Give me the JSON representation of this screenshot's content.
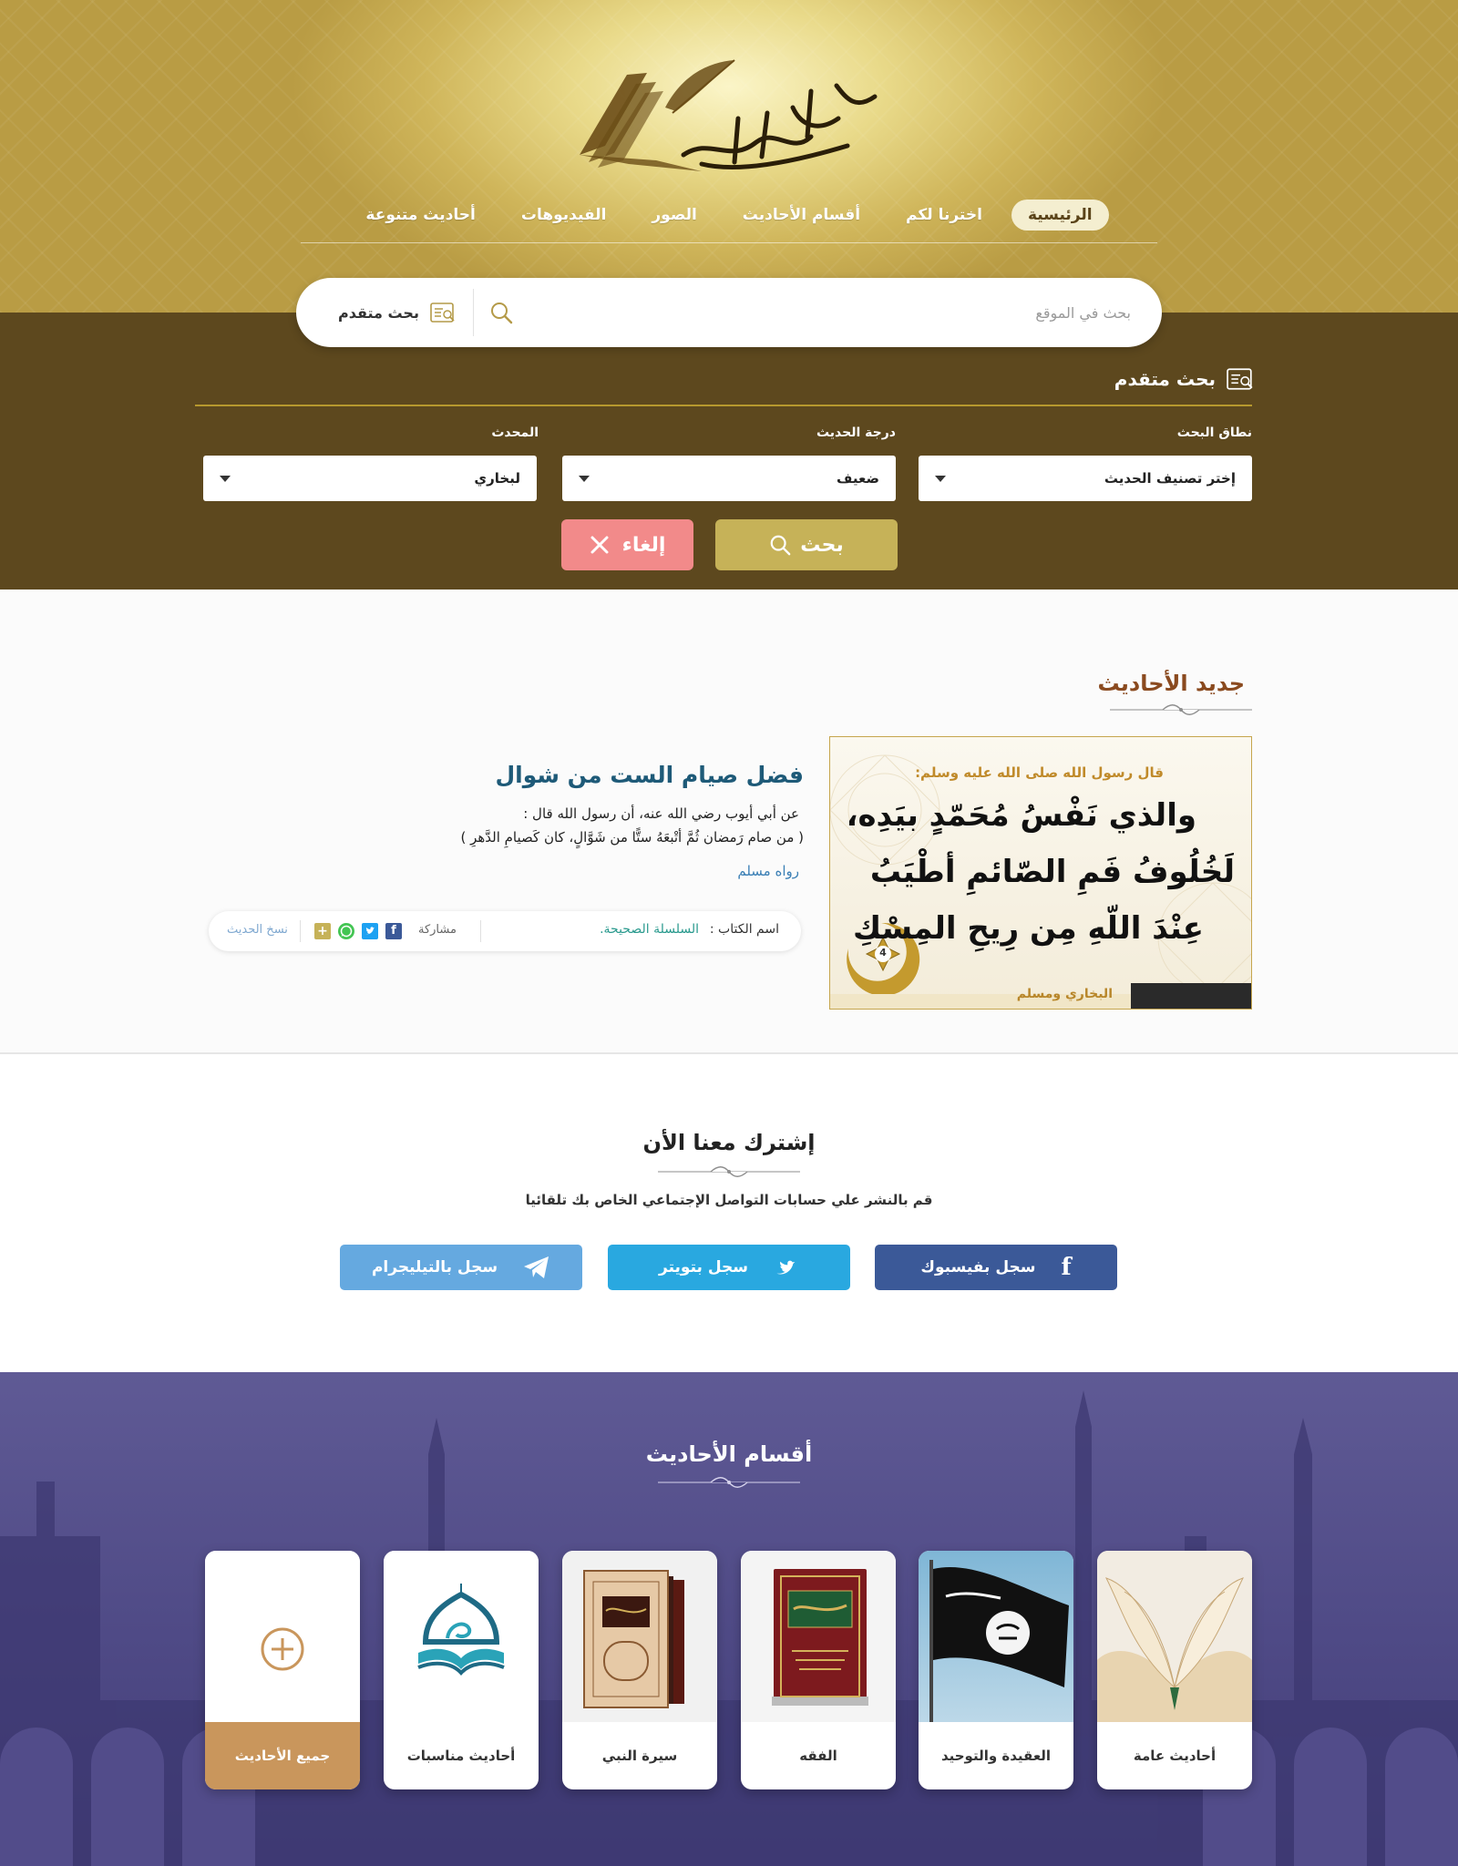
{
  "nav": {
    "items": [
      "الرئيسية",
      "اخترنا لكم",
      "أقسام الأحاديث",
      "الصور",
      "الفيديوهات",
      "أحاديث متنوعة"
    ],
    "active_index": 0
  },
  "search": {
    "placeholder": "بحث في الموقع",
    "advanced_link": "بحث متقدم"
  },
  "advanced": {
    "title": "بحث متقدم",
    "scope_label": "نطاق البحث",
    "scope_value": "إختر تصنيف الحديث",
    "grade_label": "درجة الحديث",
    "grade_value": "ضعيف",
    "narrator_label": "المحدث",
    "narrator_value": "لبخاري",
    "search_button": "بحث",
    "cancel_button": "إلغاء"
  },
  "latest": {
    "section_title": "جديد الأحاديث",
    "hadith_title": "فضل صيام الست من شوال",
    "text_line1": "عن أبي أيوب رضي الله عنه، أن رسول الله قال :",
    "text_line2": "( من صام رَمضان ثُمَّ أتْبعَهُ ستًّا من شَوَّالٍ، كان كَصيامِ الدَّهرِ )",
    "narrator": "رواه مسلم",
    "book_label": "اسم الكتاب :",
    "book_name": "السلسلة الصحيحة.",
    "share_label": "مشاركة",
    "copy_label": "نسخ الحديث",
    "image": {
      "header": "قال رسول الله صلى الله عليه وسلم:",
      "line1": "والذي نَفْسُ مُحَمّدٍ بيَدِه،",
      "line2": "لَخُلُوفُ فَمِ الصّائمِ أطْيَبُ",
      "line3": "عِنْدَ اللّهِ مِن رِيحِ المِسْكِ",
      "source": "البخاري ومسلم",
      "badge": "4"
    }
  },
  "subscribe": {
    "title": "إشترك معنا الأن",
    "text": "قم بالنشر علي حسابات التواصل الإجتماعي الخاص بك تلقائيا",
    "facebook": "سجل بفيسبوك",
    "twitter": "سجل بتويتر",
    "telegram": "سجل بالتيليجرام"
  },
  "categories": {
    "title": "أقسام الأحاديث",
    "items": [
      "أحاديث عامة",
      "العقيدة والتوحيد",
      "الفقه",
      "سيرة النبي",
      "أحاديث مناسبات",
      "جميع الأحاديث"
    ]
  },
  "colors": {
    "gold": "#c6b258",
    "brown": "#5d481e",
    "cancel": "#f28a8a",
    "facebook": "#3b5998",
    "twitter": "#1da1f2",
    "telegram": "#65a9e0",
    "purple": "#4d4884",
    "all_hadith": "#c9965c"
  }
}
